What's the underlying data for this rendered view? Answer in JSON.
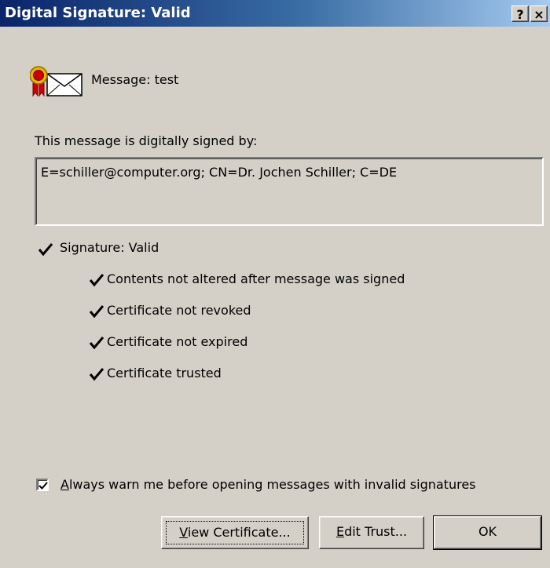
{
  "window": {
    "title": "Digital Signature: Valid",
    "help_button": "?",
    "close_button": "×"
  },
  "message": {
    "label": "Message:   test",
    "icon": "signed-envelope-icon"
  },
  "signer": {
    "intro": "This message is digitally signed by:",
    "value": "E=schiller@computer.org; CN=Dr. Jochen Schiller; C=DE"
  },
  "status": {
    "signature": "Signature: Valid",
    "checks": [
      "Contents not altered after message was signed",
      "Certificate not revoked",
      "Certificate not expired",
      "Certificate trusted"
    ]
  },
  "warn_option": {
    "checked": true,
    "label_first": "A",
    "label_rest": "lways warn me before opening messages with invalid signatures"
  },
  "buttons": {
    "view_first": "V",
    "view_rest": "iew Certificate...",
    "edit_first": "E",
    "edit_rest": "dit Trust...",
    "ok": "OK"
  },
  "colors": {
    "dialog_bg": "#d4d0c8",
    "title_gradient_start": "#0a246a",
    "title_gradient_end": "#a6caf0"
  }
}
